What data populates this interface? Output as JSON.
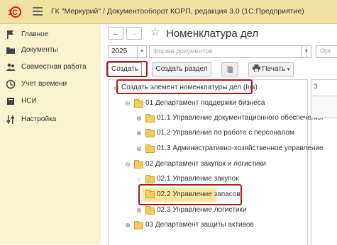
{
  "titlebar": {
    "logo_text": "1С",
    "title": "ГК \"Меркурий\" / Документооборот КОРП, редакция 3.0  (1С:Предприятие)"
  },
  "sidebar": {
    "items": [
      {
        "label": "Главное",
        "icon": "flag-icon"
      },
      {
        "label": "Документы",
        "icon": "folder-icon"
      },
      {
        "label": "Совместная работа",
        "icon": "users-icon"
      },
      {
        "label": "Учет времени",
        "icon": "clock-icon"
      },
      {
        "label": "НСИ",
        "icon": "book-icon"
      },
      {
        "label": "Настройка",
        "icon": "sliders-icon"
      }
    ]
  },
  "header": {
    "back": "←",
    "forward": "→",
    "star": "☆",
    "title": "Номенклатура дел"
  },
  "filters": {
    "year": "2025",
    "doc_form_placeholder": "Форма документов",
    "org_placeholder": "Орг"
  },
  "toolbar": {
    "create_label": "Создать",
    "create_section_label": "Создать раздел",
    "print_label": "Печать"
  },
  "tree": {
    "root_label": "Создать элемент номенклатуры дел (Ins)",
    "rows": [
      {
        "label": "01 Департамент поддержки бизнеса",
        "exp": "⊖"
      },
      {
        "label": "01.1 Управление документационного обеспечения",
        "exp": "⊕"
      },
      {
        "label": "01.2 Управление по работе с персоналом",
        "exp": "⊕"
      },
      {
        "label": "01.3 Административно-хозяйственное управление",
        "exp": "⊕"
      },
      {
        "label": "02 Департамент закупок и логистики",
        "exp": "⊖"
      },
      {
        "label": "02.1 Управление закупок",
        "exp": "○"
      },
      {
        "label": "02.2 Управление запасов",
        "exp": ""
      },
      {
        "label": "02.3 Управление логистики",
        "exp": "⊕"
      },
      {
        "label": "03 Департамент защиты активов",
        "exp": "⊕"
      }
    ]
  },
  "right_panel": {
    "header": "З"
  },
  "colors": {
    "titlebar": "#f2e2a2",
    "sidebar": "#fbf2cf",
    "highlight": "#b11a1a"
  }
}
